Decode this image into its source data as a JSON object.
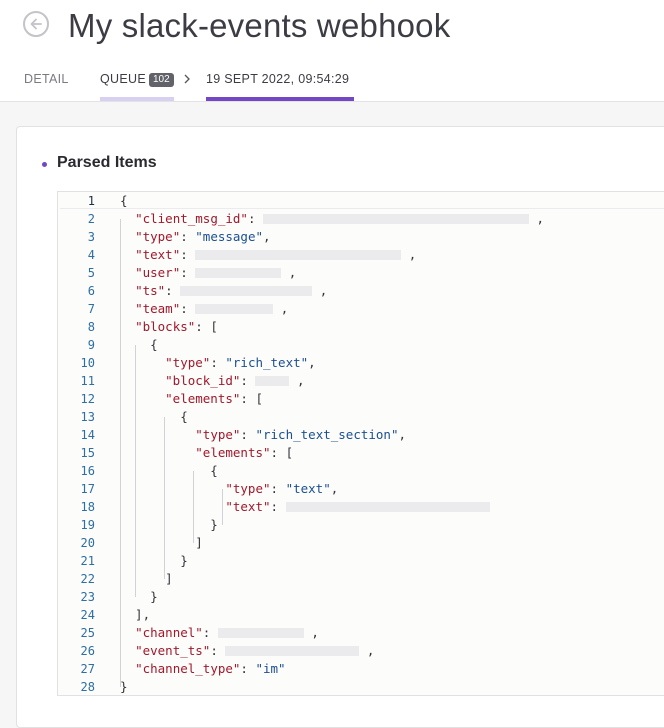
{
  "header": {
    "title": "My slack-events webhook",
    "tabs": {
      "detail": "DETAIL",
      "queue": "QUEUE",
      "queue_count": "102",
      "date": "19 SEPT 2022, 09:54:29"
    },
    "colors": {
      "accent": "#7448c4",
      "queue_underline": "#d7d0f0"
    }
  },
  "section": {
    "title": "Parsed Items"
  },
  "code": {
    "line_numbers": [
      "1",
      "2",
      "3",
      "4",
      "5",
      "6",
      "7",
      "8",
      "9",
      "10",
      "11",
      "12",
      "13",
      "14",
      "15",
      "16",
      "17",
      "18",
      "19",
      "20",
      "21",
      "22",
      "23",
      "24",
      "25",
      "26",
      "27",
      "28"
    ],
    "keys": {
      "client_msg_id": "\"client_msg_id\"",
      "type": "\"type\"",
      "text": "\"text\"",
      "user": "\"user\"",
      "ts": "\"ts\"",
      "team": "\"team\"",
      "blocks": "\"blocks\"",
      "block_id": "\"block_id\"",
      "elements": "\"elements\"",
      "channel": "\"channel\"",
      "event_ts": "\"event_ts\"",
      "channel_type": "\"channel_type\""
    },
    "values": {
      "type_message": "\"message\"",
      "type_rich_text": "\"rich_text\"",
      "type_rich_text_section": "\"rich_text_section\"",
      "type_text": "\"text\"",
      "channel_type_im": "\"im\""
    }
  }
}
